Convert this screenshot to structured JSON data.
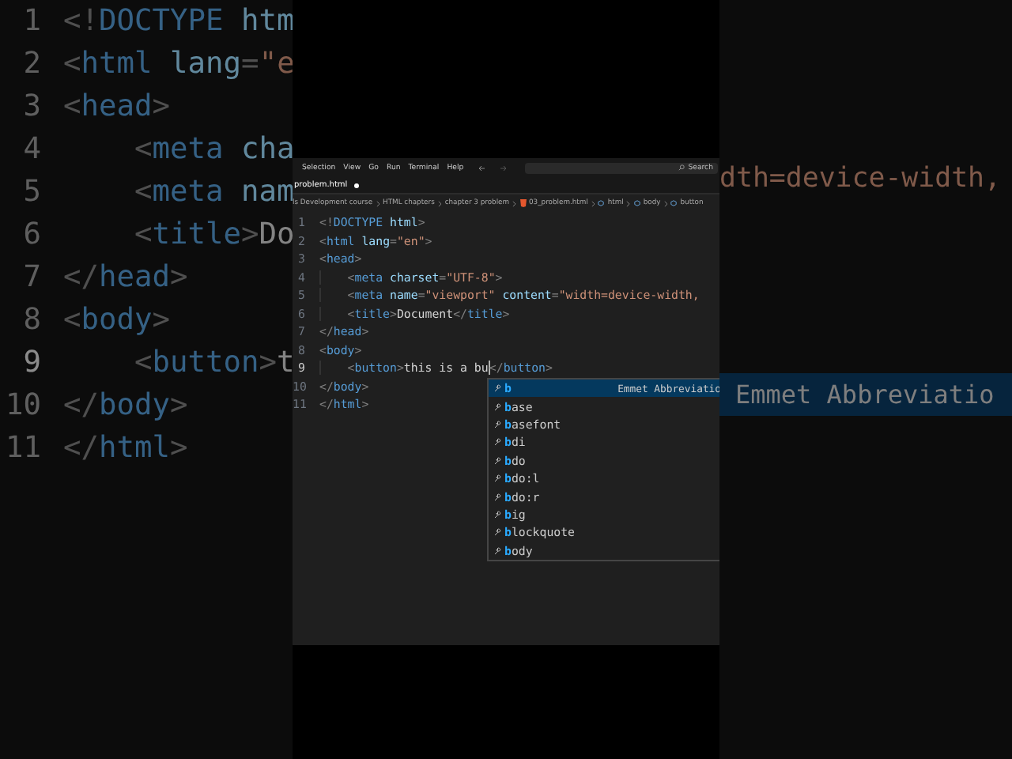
{
  "backdrop": {
    "lines": [
      {
        "no": "1",
        "active": false,
        "tokens": [
          {
            "kind": "punct",
            "text": "<!"
          },
          {
            "kind": "tag",
            "text": "DOCTYPE"
          },
          {
            "kind": "attr",
            "text": " htm"
          }
        ]
      },
      {
        "no": "2",
        "active": false,
        "tokens": [
          {
            "kind": "punct",
            "text": "<"
          },
          {
            "kind": "tag",
            "text": "html"
          },
          {
            "kind": "attr",
            "text": " lang"
          },
          {
            "kind": "punct",
            "text": "="
          },
          {
            "kind": "string",
            "text": "\"e"
          }
        ]
      },
      {
        "no": "3",
        "active": false,
        "tokens": [
          {
            "kind": "punct",
            "text": "<"
          },
          {
            "kind": "tag",
            "text": "head"
          },
          {
            "kind": "punct",
            "text": ">"
          }
        ]
      },
      {
        "no": "4",
        "active": false,
        "tokens": [
          {
            "kind": "punct",
            "text": "    <"
          },
          {
            "kind": "tag",
            "text": "meta"
          },
          {
            "kind": "attr",
            "text": " cha"
          }
        ]
      },
      {
        "no": "5",
        "active": false,
        "tokens": [
          {
            "kind": "punct",
            "text": "    <"
          },
          {
            "kind": "tag",
            "text": "meta"
          },
          {
            "kind": "attr",
            "text": " nam"
          }
        ]
      },
      {
        "no": "6",
        "active": false,
        "tokens": [
          {
            "kind": "punct",
            "text": "    <"
          },
          {
            "kind": "tag",
            "text": "title"
          },
          {
            "kind": "punct",
            "text": ">"
          },
          {
            "kind": "text",
            "text": "Do"
          }
        ]
      },
      {
        "no": "7",
        "active": false,
        "tokens": [
          {
            "kind": "punct",
            "text": "</"
          },
          {
            "kind": "tag",
            "text": "head"
          },
          {
            "kind": "punct",
            "text": ">"
          }
        ]
      },
      {
        "no": "8",
        "active": false,
        "tokens": [
          {
            "kind": "punct",
            "text": "<"
          },
          {
            "kind": "tag",
            "text": "body"
          },
          {
            "kind": "punct",
            "text": ">"
          }
        ]
      },
      {
        "no": "9",
        "active": true,
        "tokens": [
          {
            "kind": "punct",
            "text": "    <"
          },
          {
            "kind": "tag",
            "text": "button"
          },
          {
            "kind": "punct",
            "text": ">"
          },
          {
            "kind": "text",
            "text": "t"
          }
        ]
      },
      {
        "no": "10",
        "active": false,
        "tokens": [
          {
            "kind": "punct",
            "text": "</"
          },
          {
            "kind": "tag",
            "text": "body"
          },
          {
            "kind": "punct",
            "text": ">"
          }
        ]
      },
      {
        "no": "11",
        "active": false,
        "tokens": [
          {
            "kind": "punct",
            "text": "</"
          },
          {
            "kind": "tag",
            "text": "html"
          },
          {
            "kind": "punct",
            "text": ">"
          }
        ]
      }
    ],
    "right_line": "dth=device-width,",
    "right_suggestion_detail": "Emmet Abbreviatio"
  },
  "editor": {
    "menu": [
      "Selection",
      "View",
      "Go",
      "Run",
      "Terminal",
      "Help"
    ],
    "search": {
      "placeholder": "Search"
    },
    "tab": {
      "label": "problem.html",
      "modified": true
    },
    "breadcrumbs": [
      {
        "kind": "folder",
        "label": "ls Development course"
      },
      {
        "kind": "folder",
        "label": "HTML chapters"
      },
      {
        "kind": "folder",
        "label": "chapter 3 problem"
      },
      {
        "kind": "file",
        "label": "03_problem.html"
      },
      {
        "kind": "element",
        "label": "html"
      },
      {
        "kind": "element",
        "label": "body"
      },
      {
        "kind": "element",
        "label": "button"
      }
    ],
    "lines": [
      {
        "no": "1",
        "active": false,
        "tokens": [
          {
            "kind": "punct",
            "text": "<!"
          },
          {
            "kind": "tag",
            "text": "DOCTYPE"
          },
          {
            "kind": "attr",
            "text": " html"
          },
          {
            "kind": "punct",
            "text": ">"
          }
        ]
      },
      {
        "no": "2",
        "active": false,
        "tokens": [
          {
            "kind": "punct",
            "text": "<"
          },
          {
            "kind": "tag",
            "text": "html"
          },
          {
            "kind": "attr",
            "text": " lang"
          },
          {
            "kind": "punct",
            "text": "="
          },
          {
            "kind": "string",
            "text": "\"en\""
          },
          {
            "kind": "punct",
            "text": ">"
          }
        ]
      },
      {
        "no": "3",
        "active": false,
        "tokens": [
          {
            "kind": "punct",
            "text": "<"
          },
          {
            "kind": "tag",
            "text": "head"
          },
          {
            "kind": "punct",
            "text": ">"
          }
        ]
      },
      {
        "no": "4",
        "active": false,
        "tokens": [
          {
            "kind": "punct",
            "text": "    <"
          },
          {
            "kind": "tag",
            "text": "meta"
          },
          {
            "kind": "attr",
            "text": " charset"
          },
          {
            "kind": "punct",
            "text": "="
          },
          {
            "kind": "string",
            "text": "\"UTF-8\""
          },
          {
            "kind": "punct",
            "text": ">"
          }
        ]
      },
      {
        "no": "5",
        "active": false,
        "tokens": [
          {
            "kind": "punct",
            "text": "    <"
          },
          {
            "kind": "tag",
            "text": "meta"
          },
          {
            "kind": "attr",
            "text": " name"
          },
          {
            "kind": "punct",
            "text": "="
          },
          {
            "kind": "string",
            "text": "\"viewport\""
          },
          {
            "kind": "attr",
            "text": " content"
          },
          {
            "kind": "punct",
            "text": "="
          },
          {
            "kind": "string",
            "text": "\"width=device-width,"
          }
        ]
      },
      {
        "no": "6",
        "active": false,
        "tokens": [
          {
            "kind": "punct",
            "text": "    <"
          },
          {
            "kind": "tag",
            "text": "title"
          },
          {
            "kind": "punct",
            "text": ">"
          },
          {
            "kind": "text",
            "text": "Document"
          },
          {
            "kind": "punct",
            "text": "</"
          },
          {
            "kind": "tag",
            "text": "title"
          },
          {
            "kind": "punct",
            "text": ">"
          }
        ]
      },
      {
        "no": "7",
        "active": false,
        "tokens": [
          {
            "kind": "punct",
            "text": "</"
          },
          {
            "kind": "tag",
            "text": "head"
          },
          {
            "kind": "punct",
            "text": ">"
          }
        ]
      },
      {
        "no": "8",
        "active": false,
        "tokens": [
          {
            "kind": "punct",
            "text": "<"
          },
          {
            "kind": "tag",
            "text": "body"
          },
          {
            "kind": "punct",
            "text": ">"
          }
        ]
      },
      {
        "no": "9",
        "active": true,
        "tokens": [
          {
            "kind": "punct",
            "text": "    <"
          },
          {
            "kind": "tag",
            "text": "button"
          },
          {
            "kind": "punct",
            "text": ">"
          },
          {
            "kind": "text",
            "text": "this is a bu",
            "caret": true
          },
          {
            "kind": "punct",
            "text": "</"
          },
          {
            "kind": "tag",
            "text": "button"
          },
          {
            "kind": "punct",
            "text": ">"
          }
        ]
      },
      {
        "no": "10",
        "active": false,
        "tokens": [
          {
            "kind": "punct",
            "text": "</"
          },
          {
            "kind": "tag",
            "text": "body"
          },
          {
            "kind": "punct",
            "text": ">"
          }
        ]
      },
      {
        "no": "11",
        "active": false,
        "tokens": [
          {
            "kind": "punct",
            "text": "</"
          },
          {
            "kind": "tag",
            "text": "html"
          },
          {
            "kind": "punct",
            "text": ">"
          }
        ]
      }
    ],
    "suggestions": [
      {
        "match": "b",
        "selected": true,
        "detail": "Emmet Abbreviatio"
      },
      {
        "match": "b",
        "rest": "ase",
        "selected": false
      },
      {
        "match": "b",
        "rest": "asefont",
        "selected": false
      },
      {
        "match": "b",
        "rest": "di",
        "selected": false
      },
      {
        "match": "b",
        "rest": "do",
        "selected": false
      },
      {
        "match": "b",
        "rest": "do:l",
        "selected": false
      },
      {
        "match": "b",
        "rest": "do:r",
        "selected": false
      },
      {
        "match": "b",
        "rest": "ig",
        "selected": false
      },
      {
        "match": "b",
        "rest": "lockquote",
        "selected": false
      },
      {
        "match": "b",
        "rest": "ody",
        "selected": false
      }
    ]
  }
}
